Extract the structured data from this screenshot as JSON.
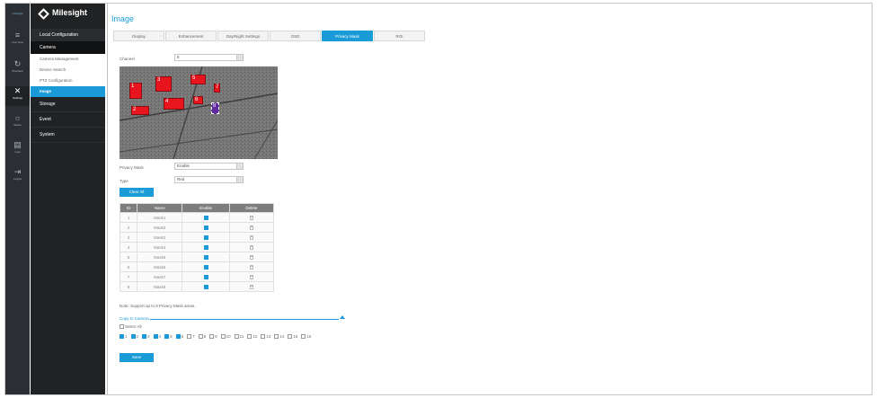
{
  "rail": {
    "logo": "milesight",
    "items": [
      {
        "icon": "live-view-icon",
        "glyph": "≡",
        "label": "Live View"
      },
      {
        "icon": "playback-icon",
        "glyph": "↻",
        "label": "Playback"
      },
      {
        "icon": "settings-icon",
        "glyph": "✕",
        "label": "Settings"
      },
      {
        "icon": "status-icon",
        "glyph": "☼",
        "label": "Status"
      },
      {
        "icon": "logs-icon",
        "glyph": "▤",
        "label": "Logs"
      },
      {
        "icon": "logout-icon",
        "glyph": "⇥",
        "label": "Logout"
      }
    ]
  },
  "menu": {
    "brand": "Milesight",
    "local_config": "Local Configuration",
    "camera": "Camera",
    "sub": [
      "Camera Management",
      "Device Search",
      "PTZ Configuration",
      "Image"
    ],
    "groups": [
      "Storage",
      "Event",
      "System"
    ]
  },
  "page": {
    "title": "Image",
    "tabs": [
      "Display",
      "Enhancement",
      "Day/Night Settings",
      "OSD",
      "Privacy Mask",
      "ROI"
    ],
    "active_tab": "Privacy Mask"
  },
  "form": {
    "channel_label": "Channel",
    "channel_value": "8",
    "privacy_mask_label": "Privacy Mask",
    "privacy_mask_value": "Enable",
    "type_label": "Type",
    "type_value": "Red",
    "clear_all": "Clear All"
  },
  "masks": [
    "1",
    "2",
    "3",
    "4",
    "5",
    "6",
    "7",
    "8"
  ],
  "table": {
    "headers": [
      "ID",
      "Name",
      "Enable",
      "Delete"
    ],
    "rows": [
      {
        "id": "1",
        "name": "Mask1"
      },
      {
        "id": "2",
        "name": "Mask2"
      },
      {
        "id": "3",
        "name": "Mask3"
      },
      {
        "id": "4",
        "name": "Mask4"
      },
      {
        "id": "5",
        "name": "Mask5"
      },
      {
        "id": "6",
        "name": "Mask6"
      },
      {
        "id": "7",
        "name": "Mask7"
      },
      {
        "id": "8",
        "name": "Mask8"
      }
    ]
  },
  "note": "Note: Support up to 8 Privacy Mask areas.",
  "copy": {
    "title": "Copy to Camera",
    "select_all": "Select All",
    "cameras": [
      {
        "label": "1",
        "checked": true
      },
      {
        "label": "2",
        "checked": true
      },
      {
        "label": "3",
        "checked": true
      },
      {
        "label": "4",
        "checked": true
      },
      {
        "label": "5",
        "checked": true
      },
      {
        "label": "6",
        "checked": true
      },
      {
        "label": "7",
        "checked": false
      },
      {
        "label": "8",
        "checked": false
      },
      {
        "label": "9",
        "checked": false
      },
      {
        "label": "10",
        "checked": false
      },
      {
        "label": "11",
        "checked": false
      },
      {
        "label": "12",
        "checked": false
      },
      {
        "label": "13",
        "checked": false
      },
      {
        "label": "14",
        "checked": false
      },
      {
        "label": "15",
        "checked": false
      },
      {
        "label": "16",
        "checked": false
      }
    ]
  },
  "save": "Save",
  "colors": {
    "accent": "#1a9bd7",
    "mask_red": "#e8141e",
    "sidebar": "#202224"
  }
}
